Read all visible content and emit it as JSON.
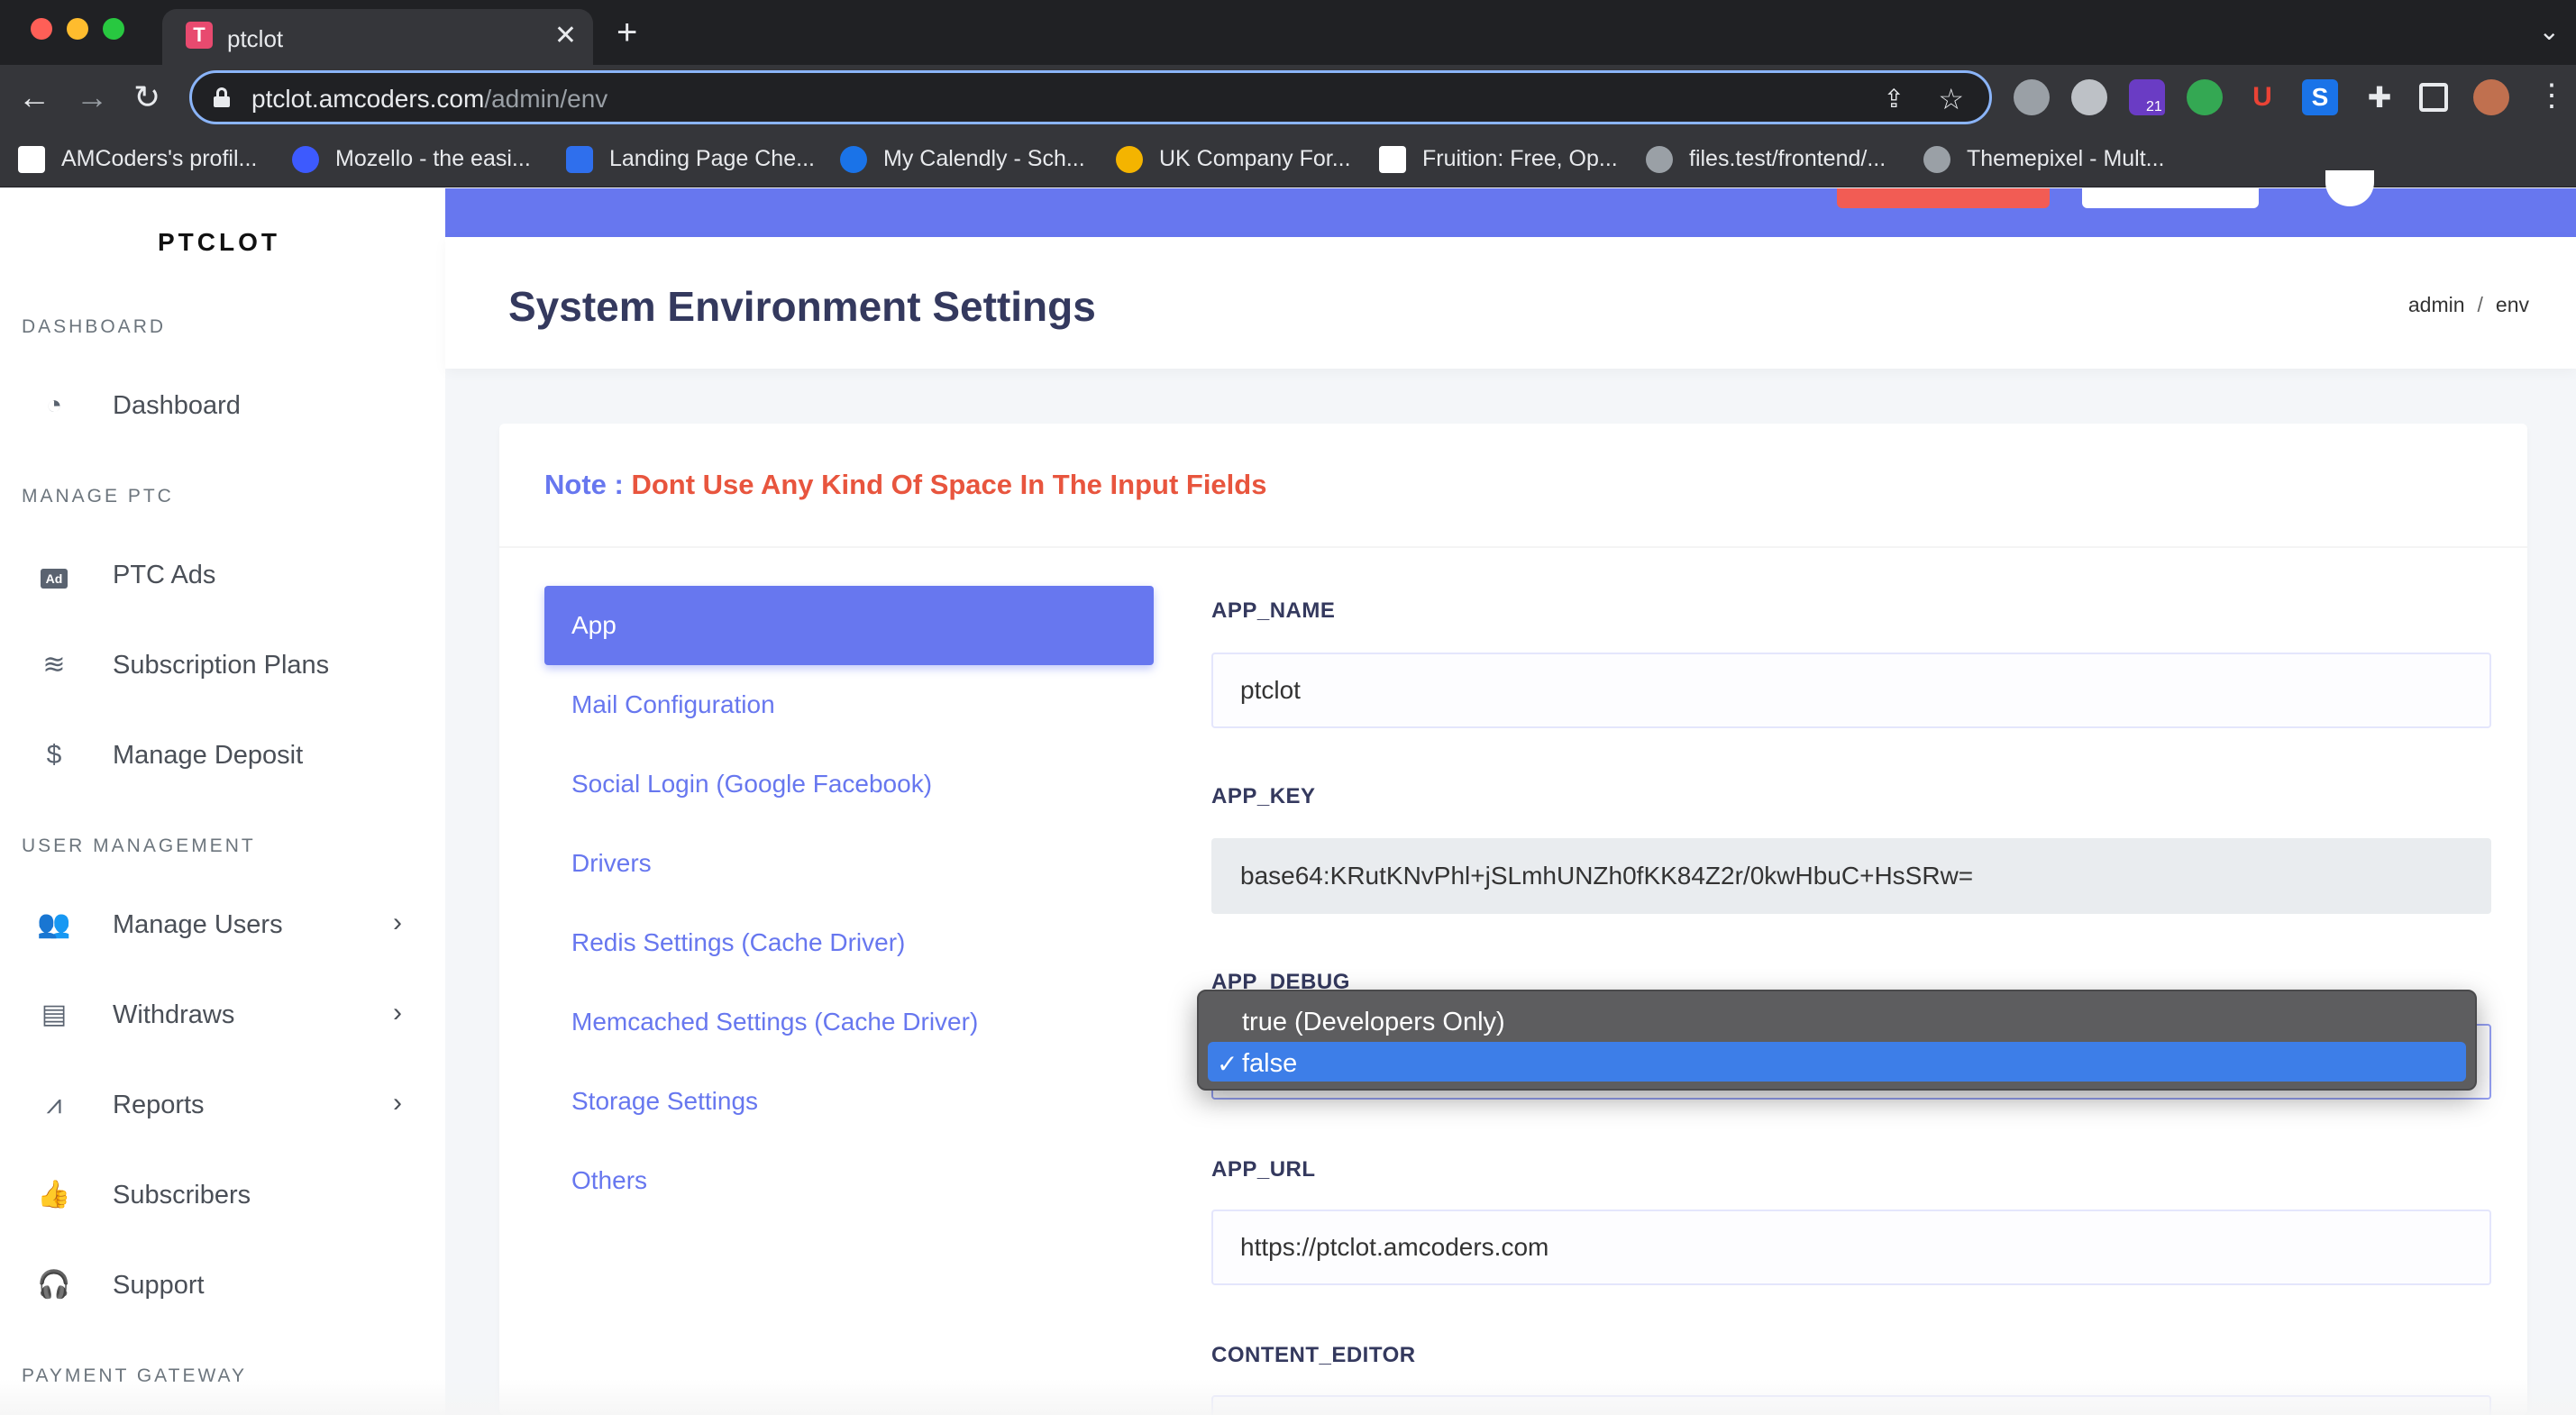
{
  "browser": {
    "tab_title": "ptclot",
    "tab_favicon_letter": "T",
    "url_host": "ptclot.amcoders.com",
    "url_path": "/admin/env",
    "extension_badge": "21",
    "bookmarks": [
      {
        "label": "AMCoders's profil...",
        "icon_color": "#ffffff"
      },
      {
        "label": "Mozello - the easi...",
        "icon_color": "#3d5afe"
      },
      {
        "label": "Landing Page Che...",
        "icon_color": "#2f6fed"
      },
      {
        "label": "My Calendly - Sch...",
        "icon_color": "#1a73e8"
      },
      {
        "label": "UK Company For...",
        "icon_color": "#f4b400"
      },
      {
        "label": "Fruition: Free, Op...",
        "icon_color": "#ffffff"
      },
      {
        "label": "files.test/frontend/...",
        "icon_color": "#9aa0a6"
      },
      {
        "label": "Themepixel - Mult...",
        "icon_color": "#9aa0a6"
      }
    ]
  },
  "sidebar": {
    "brand": "PTCLOT",
    "sections": {
      "dashboard": "DASHBOARD",
      "manage_ptc": "MANAGE PTC",
      "user_management": "USER MANAGEMENT",
      "payment_gateway": "PAYMENT GATEWAY"
    },
    "items": {
      "dashboard": "Dashboard",
      "ptc_ads": "PTC Ads",
      "subscription_plans": "Subscription Plans",
      "manage_deposit": "Manage Deposit",
      "manage_users": "Manage Users",
      "withdraws": "Withdraws",
      "reports": "Reports",
      "subscribers": "Subscribers",
      "support": "Support"
    },
    "icons": {
      "dashboard": "tachometer-icon",
      "ptc_ads": "ad-icon",
      "subscription_plans": "layers-icon",
      "manage_deposit": "dollar-icon",
      "manage_users": "users-icon",
      "withdraws": "invoice-icon",
      "reports": "chart-line-icon",
      "subscribers": "thumbs-up-icon",
      "support": "headset-icon"
    }
  },
  "header": {
    "title": "System Environment Settings",
    "breadcrumb": [
      "admin",
      "env"
    ]
  },
  "note": {
    "label": "Note :",
    "text": "Dont Use Any Kind Of Space In The Input Fields"
  },
  "tabs": [
    "App",
    "Mail Configuration",
    "Social Login (Google Facebook)",
    "Drivers",
    "Redis Settings (Cache Driver)",
    "Memcached Settings (Cache Driver)",
    "Storage Settings",
    "Others"
  ],
  "active_tab": "App",
  "fields": {
    "app_name": {
      "label": "APP_NAME",
      "value": "ptclot"
    },
    "app_key": {
      "label": "APP_KEY",
      "value": "base64:KRutKNvPhl+jSLmhUNZh0fKK84Z2r/0kwHbuC+HsSRw="
    },
    "app_debug": {
      "label": "APP_DEBUG",
      "options": [
        "true (Developers Only)",
        "false"
      ],
      "selected": "false"
    },
    "app_url": {
      "label": "APP_URL",
      "value": "https://ptclot.amcoders.com"
    },
    "content_editor": {
      "label": "CONTENT_EDITOR"
    }
  },
  "colors": {
    "primary": "#6777ef",
    "note_text": "#e8553e",
    "dropdown_bg": "#5d5d5f",
    "dropdown_selected": "#3d7ee8"
  }
}
